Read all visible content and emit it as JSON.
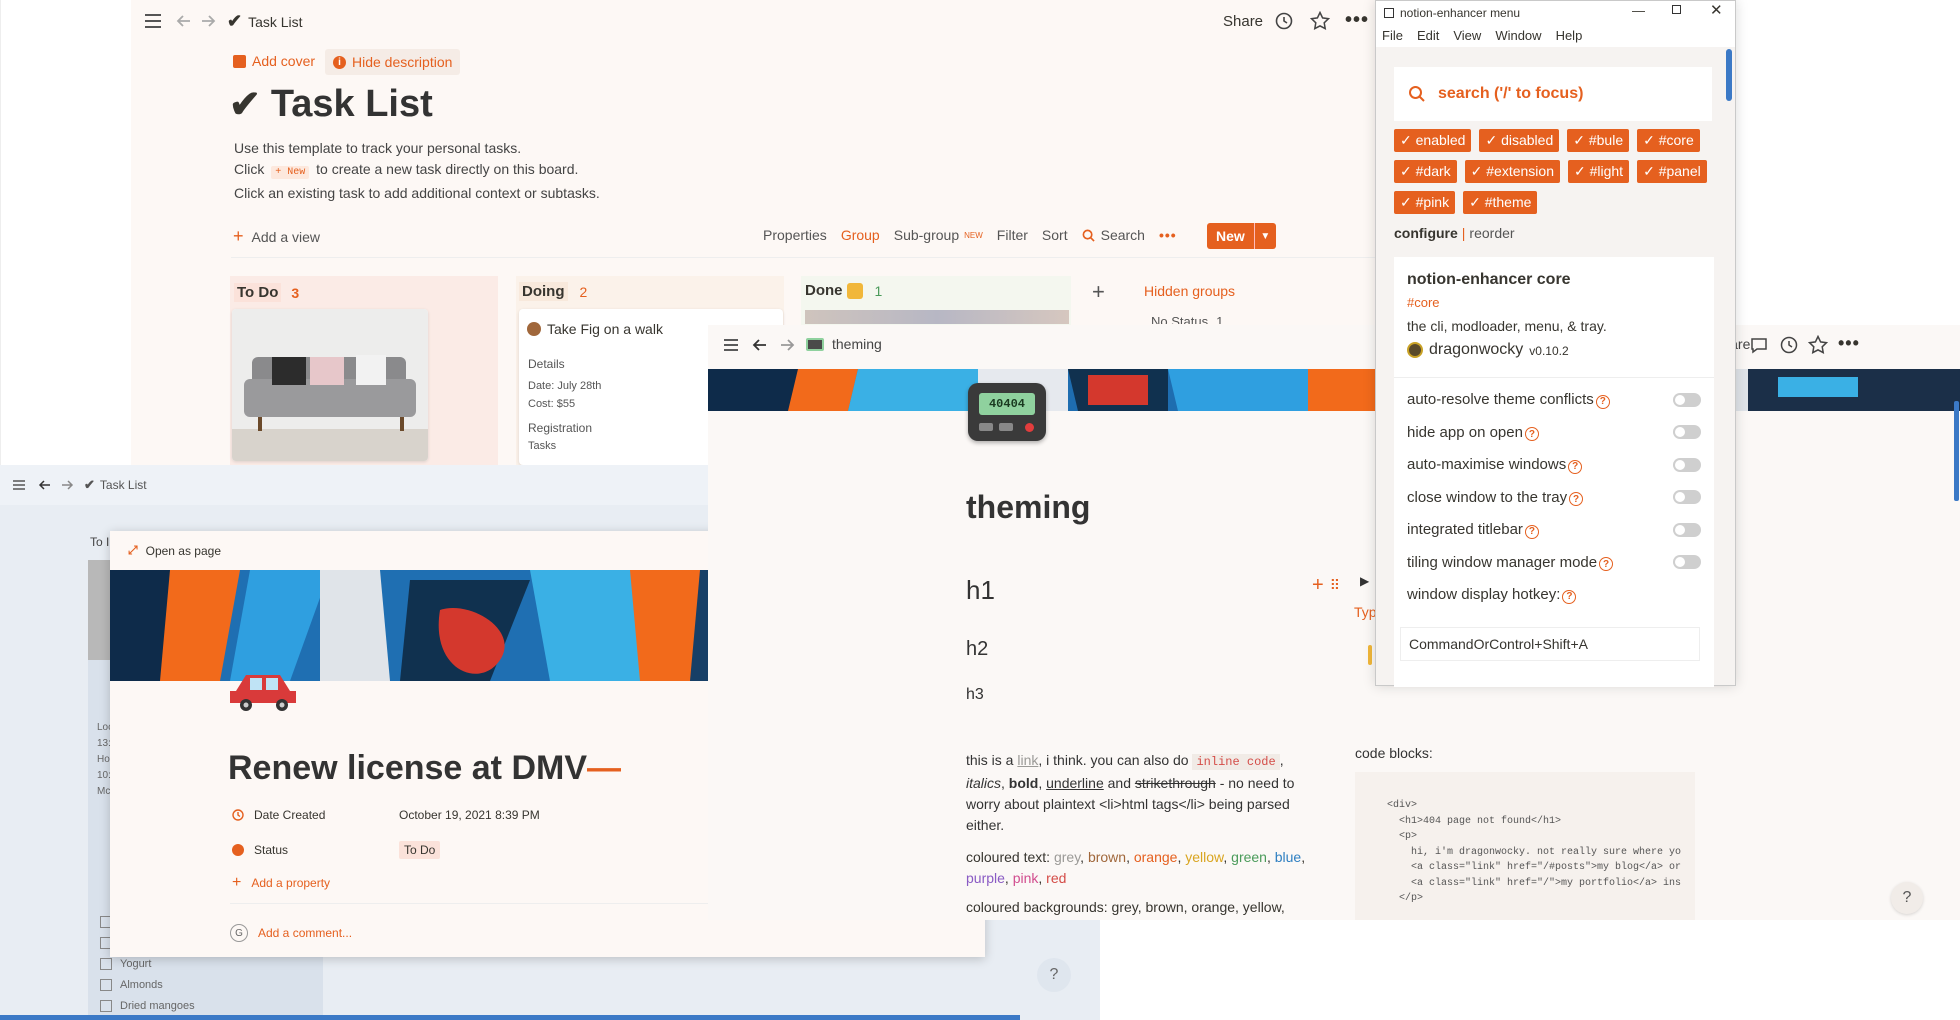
{
  "taskList": {
    "breadcrumb": "Task List",
    "share": "Share",
    "addCover": "Add cover",
    "hideDescription": "Hide description",
    "title": "Task List",
    "desc1": "Use this template to track your personal tasks.",
    "desc2a": "Click",
    "desc2chip": "+ New",
    "desc2b": "to create a new task directly on this board.",
    "desc3": "Click an existing task to add additional context or subtasks.",
    "addView": "Add a view",
    "toolbar": {
      "properties": "Properties",
      "group": "Group",
      "subgroup": "Sub-group",
      "newBadge": "NEW",
      "filter": "Filter",
      "sort": "Sort",
      "search": "Search",
      "new": "New"
    },
    "columns": {
      "todo": {
        "label": "To Do",
        "count": "3"
      },
      "doing": {
        "label": "Doing",
        "count": "2"
      },
      "done": {
        "label": "Done",
        "count": "1"
      },
      "hidden": "Hidden groups",
      "noStatus": "No Status",
      "noStatusCount": "1"
    },
    "doingCard": {
      "title": "Take Fig on a walk",
      "details": "Details",
      "date": "Date: July 28th",
      "cost": "Cost: $55",
      "registration": "Registration",
      "tasks": "Tasks"
    }
  },
  "taskListBack": {
    "breadcrumb": "Task List",
    "colPartial": "To I",
    "listItems": [
      "Yogurt",
      "Almonds",
      "Dried mangoes"
    ],
    "sideLabels": [
      "Loc",
      "13:",
      "Ho",
      "10:",
      "Mc"
    ]
  },
  "renew": {
    "openAsPage": "Open as page",
    "title": "Renew license at DMV",
    "titleDash": "—",
    "prop1": {
      "label": "Date Created",
      "value": "October 19, 2021 8:39 PM"
    },
    "prop2": {
      "label": "Status",
      "value": "To Do"
    },
    "addProperty": "Add a property",
    "addComment": "Add a comment...",
    "help": "?"
  },
  "theming": {
    "breadcrumb": "theming",
    "share": "Share",
    "pager": "40404",
    "title": "theming",
    "h1": "h1",
    "h2": "h2",
    "h3": "h3",
    "typPartial": "Typ",
    "para1": {
      "a": "this is a ",
      "link": "link",
      "b": ", i think. you can also do ",
      "code": "inline code",
      ",": ",",
      "italics": "italics",
      "bold": "bold",
      "and": "and",
      "underline": "underline",
      "strike": "strikethrough",
      "rest": " - no need to worry about plaintext <li>html tags</li> being parsed either."
    },
    "colouredText": {
      "label": "coloured text:",
      "items": [
        {
          "t": "grey",
          "c": "#9b9a97"
        },
        {
          "t": "brown",
          "c": "#a0673b"
        },
        {
          "t": "orange",
          "c": "#e5601f"
        },
        {
          "t": "yellow",
          "c": "#d9a520"
        },
        {
          "t": "green",
          "c": "#4a9b5a"
        },
        {
          "t": "blue",
          "c": "#2e7fc1"
        },
        {
          "t": "purple",
          "c": "#8a5bc4"
        },
        {
          "t": "pink",
          "c": "#d14c8e"
        },
        {
          "t": "red",
          "c": "#d44c47"
        }
      ]
    },
    "colouredBg": "coloured backgrounds: grey, brown, orange, yellow,",
    "codeBlocks": "code blocks:",
    "code": [
      "<div>",
      "  <h1>404 page not found</h1>",
      "  <p>",
      "    hi, i'm dragonwocky. not really sure where yo",
      "    <a class=\"link\" href=\"/#posts\">my blog</a> or",
      "    <a class=\"link\" href=\"/\">my portfolio</a> ins",
      "  </p>"
    ],
    "help": "?"
  },
  "enhancer": {
    "windowTitle": "notion-enhancer menu",
    "menu": [
      "File",
      "Edit",
      "View",
      "Window",
      "Help"
    ],
    "searchPlaceholder": "search ('/' to focus)",
    "tags": [
      "✓ enabled",
      "✓ disabled",
      "✓ #bule",
      "✓ #core",
      "✓ #dark",
      "✓ #extension",
      "✓ #light",
      "✓ #panel",
      "✓ #pink",
      "✓ #theme"
    ],
    "configure": "configure",
    "sep": "|",
    "reorder": "reorder",
    "core": {
      "title": "notion-enhancer core",
      "tag": "#core",
      "desc": "the cli, modloader, menu, & tray.",
      "author": "dragonwocky",
      "version": "v0.10.2"
    },
    "options": [
      "auto-resolve theme conflicts",
      "hide app on open",
      "auto-maximise windows",
      "close window to the tray",
      "integrated titlebar",
      "tiling window manager mode"
    ],
    "hotkeyLabel": "window display hotkey:",
    "hotkeyValue": "CommandOrControl+Shift+A",
    "qm": "?"
  },
  "colors": {
    "accent": "#e5601f",
    "background": "#fbf6f3",
    "chipBg": "#fde8dd"
  }
}
